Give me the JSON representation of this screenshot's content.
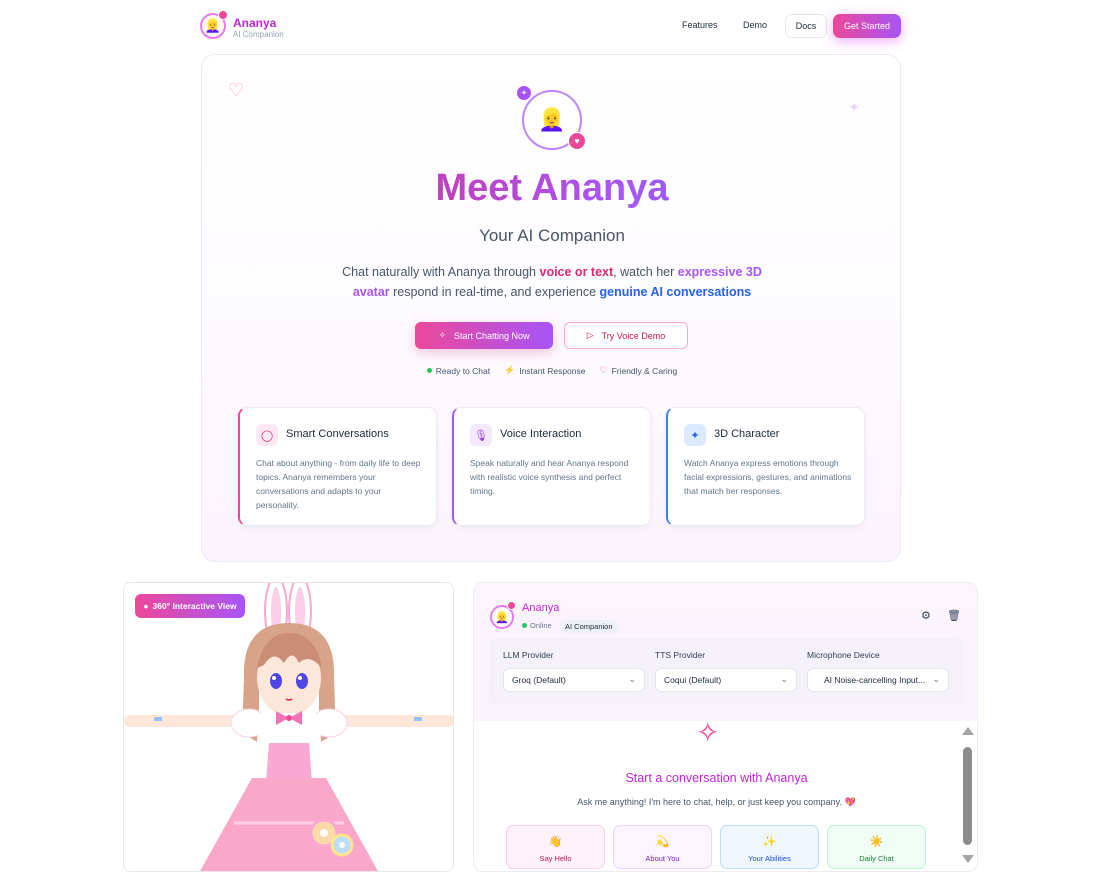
{
  "nav": {
    "brand_name": "Ananya",
    "brand_sub": "AI Companion",
    "links": [
      "Features",
      "Demo"
    ],
    "docs": "Docs",
    "cta": "Get Started"
  },
  "hero": {
    "title": "Meet Ananya",
    "subtitle": "Your AI Companion",
    "desc_1": "Chat naturally with Ananya through ",
    "desc_hl_1": "voice or text",
    "desc_2": ", watch her ",
    "desc_hl_2": "expressive 3D avatar",
    "desc_3": " respond in real-time, and experience ",
    "desc_hl_3": "genuine AI conversations",
    "primary_button": "Start Chatting Now",
    "secondary_button": "Try Voice Demo",
    "status": [
      "Ready to Chat",
      "Instant Response",
      "Friendly & Caring"
    ]
  },
  "features": [
    {
      "title": "Smart Conversations",
      "text": "Chat about anything - from daily life to deep topics. Ananya remembers your conversations and adapts to your personality.",
      "icon": "chat-bubble-icon",
      "accent": "#ec4899"
    },
    {
      "title": "Voice Interaction",
      "text": "Speak naturally and hear Ananya respond with realistic voice synthesis and perfect timing.",
      "icon": "microphone-icon",
      "accent": "#a855f7"
    },
    {
      "title": "3D Character",
      "text": "Watch Ananya express emotions through facial expressions, gestures, and animations that match her responses.",
      "icon": "sparkles-icon",
      "accent": "#3b82f6"
    }
  ],
  "avatar_panel": {
    "badge": "360° Interactive View"
  },
  "chat": {
    "name": "Ananya",
    "status": "Online",
    "tag": "AI Companion",
    "llm_label": "LLM Provider",
    "llm_value": "Groq (Default)",
    "tts_label": "TTS Provider",
    "tts_value": "Coqui (Default)",
    "mic_label": "Microphone Device",
    "mic_value": "AI Noise-cancelling Input...",
    "cta": "Start a conversation with Ananya",
    "hint": "Ask me anything! I'm here to chat, help, or just keep you company. 💖",
    "chips": [
      {
        "label": "Say Hello",
        "emoji": "👋"
      },
      {
        "label": "About You",
        "emoji": "💫"
      },
      {
        "label": "Your Abilities",
        "emoji": "✨"
      },
      {
        "label": "Daily Chat",
        "emoji": "☀️"
      }
    ]
  },
  "colors": {
    "brand_pink": "#ec4899",
    "brand_purple": "#a855f7",
    "accent_blue": "#2563eb"
  }
}
